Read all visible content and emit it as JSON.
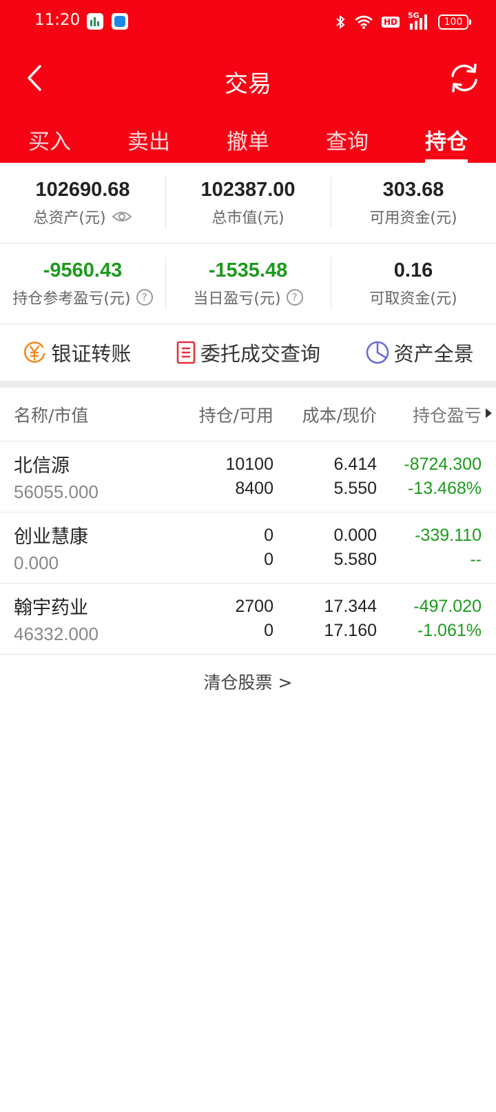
{
  "status_bar": {
    "time": "11:20",
    "hd": "HD",
    "network": "5G",
    "battery": "100"
  },
  "nav": {
    "title": "交易"
  },
  "tabs": [
    {
      "label": "买入",
      "active": false
    },
    {
      "label": "卖出",
      "active": false
    },
    {
      "label": "撤单",
      "active": false
    },
    {
      "label": "查询",
      "active": false
    },
    {
      "label": "持仓",
      "active": true
    }
  ],
  "summary": {
    "total_assets": {
      "value": "102690.68",
      "label": "总资产(元)"
    },
    "total_market_value": {
      "value": "102387.00",
      "label": "总市值(元)"
    },
    "available_funds": {
      "value": "303.68",
      "label": "可用资金(元)"
    },
    "position_pl": {
      "value": "-9560.43",
      "label": "持仓参考盈亏(元)"
    },
    "daily_pl": {
      "value": "-1535.48",
      "label": "当日盈亏(元)"
    },
    "withdrawable_funds": {
      "value": "0.16",
      "label": "可取资金(元)"
    }
  },
  "quick_actions": {
    "bank_transfer": "银证转账",
    "order_query": "委托成交查询",
    "asset_overview": "资产全景"
  },
  "table": {
    "headers": {
      "name": "名称/市值",
      "holding": "持仓/可用",
      "cost": "成本/现价",
      "pl": "持仓盈亏"
    },
    "rows": [
      {
        "name": "北信源",
        "market_value": "56055.000",
        "holding": "10100",
        "available": "8400",
        "cost": "6.414",
        "price": "5.550",
        "pl": "-8724.300",
        "pl_pct": "-13.468%"
      },
      {
        "name": "创业慧康",
        "market_value": "0.000",
        "holding": "0",
        "available": "0",
        "cost": "0.000",
        "price": "5.580",
        "pl": "-339.110",
        "pl_pct": "--"
      },
      {
        "name": "翰宇药业",
        "market_value": "46332.000",
        "holding": "2700",
        "available": "0",
        "cost": "17.344",
        "price": "17.160",
        "pl": "-497.020",
        "pl_pct": "-1.061%"
      }
    ]
  },
  "footer": {
    "clear_stocks": "清仓股票 >"
  },
  "colors": {
    "brand_red": "#f60414",
    "loss_green": "#1c9a1c"
  }
}
